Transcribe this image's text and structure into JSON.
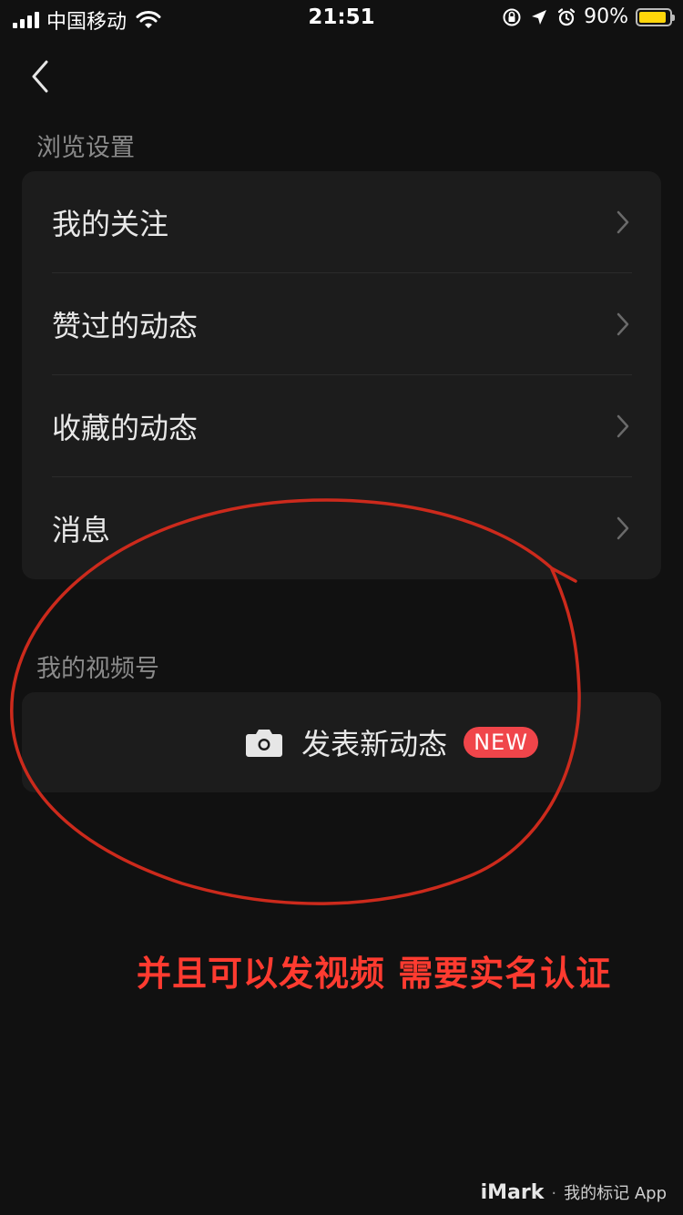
{
  "status_bar": {
    "carrier": "中国移动",
    "time": "21:51",
    "battery_percent": "90%",
    "battery_level": 0.9,
    "icons": [
      "signal-icon",
      "wifi-icon",
      "orientation-lock-icon",
      "location-icon",
      "alarm-icon",
      "battery-icon"
    ],
    "battery_color": "#ffd60a"
  },
  "nav": {
    "back_icon": "chevron-left-icon"
  },
  "browse_settings": {
    "title": "浏览设置",
    "items": [
      {
        "label": "我的关注"
      },
      {
        "label": "赞过的动态"
      },
      {
        "label": "收藏的动态"
      },
      {
        "label": "消息"
      }
    ]
  },
  "my_channel": {
    "title": "我的视频号",
    "publish_label": "发表新动态",
    "badge": "NEW",
    "icon": "camera-icon",
    "badge_color": "#f0454a"
  },
  "annotation": {
    "text": "并且可以发视频 需要实名认证",
    "color": "#ff3b30"
  },
  "watermark": {
    "brand": "iMark",
    "separator": "·",
    "rest": "我的标记 App"
  }
}
